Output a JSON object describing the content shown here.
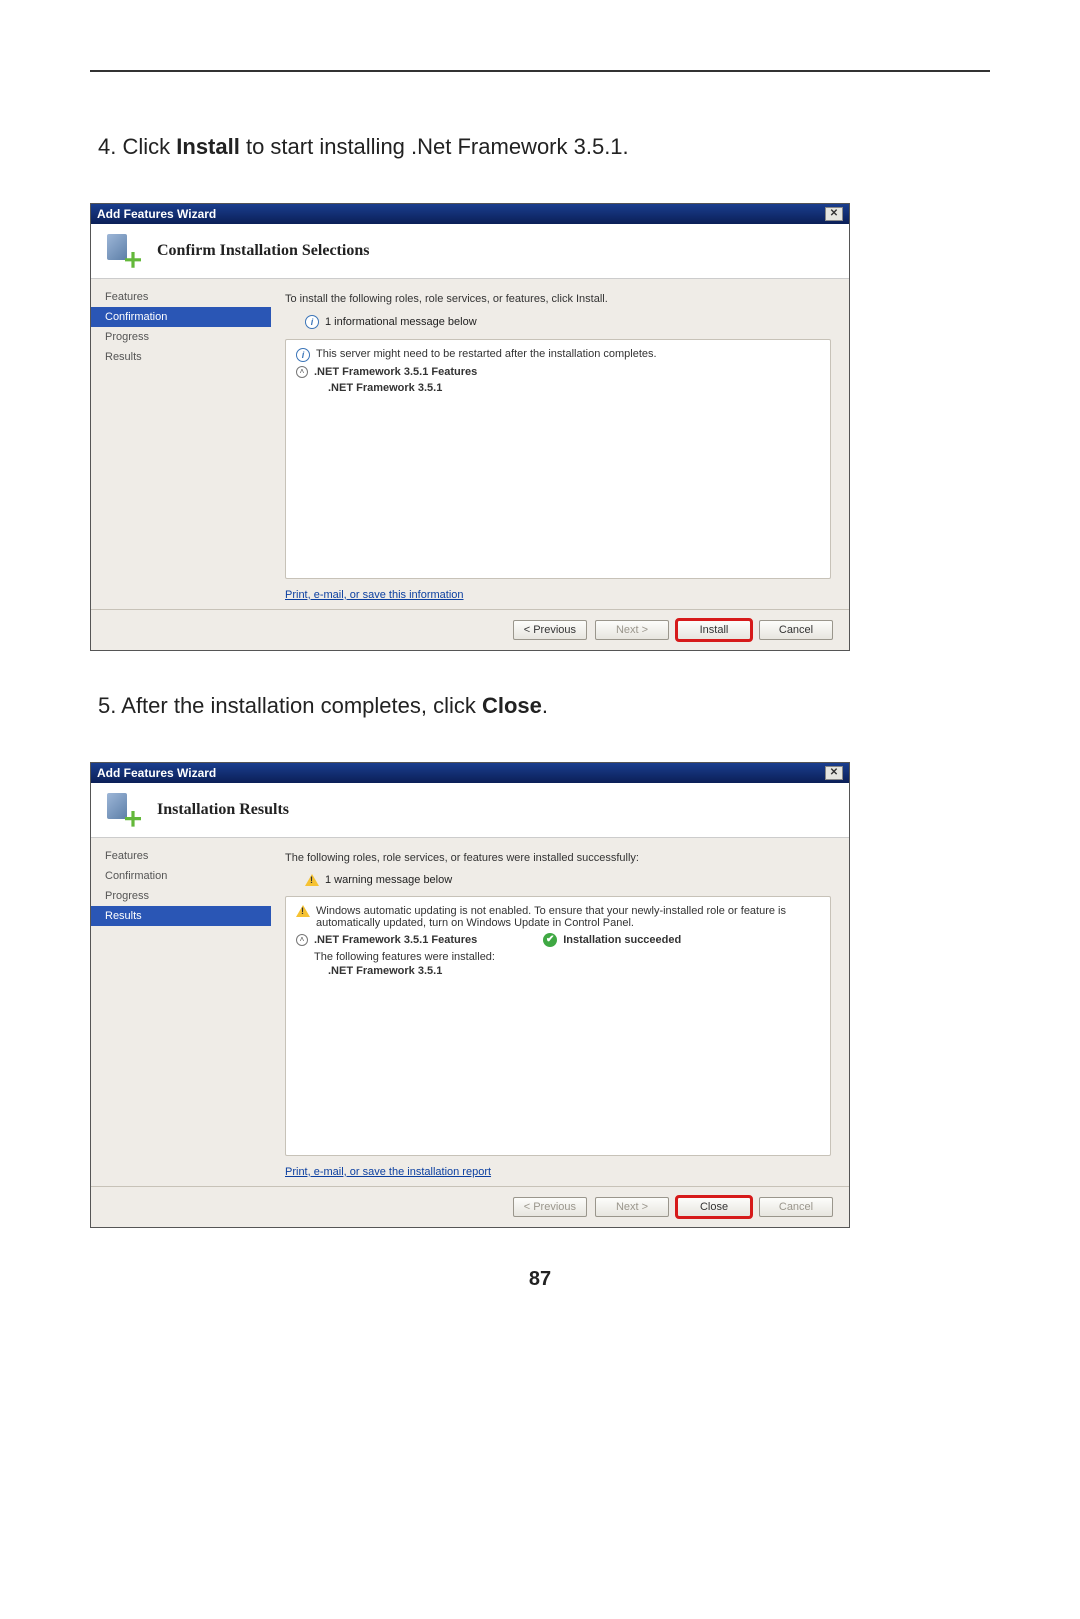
{
  "step4": {
    "num": "4.",
    "pre": "Click ",
    "bold": "Install",
    "post": " to start installing .Net Framework 3.5.1."
  },
  "step5": {
    "num": "5.",
    "pre": "After the installation completes, click ",
    "bold": "Close",
    "post": "."
  },
  "wizard1": {
    "title": "Add Features Wizard",
    "headerTitle": "Confirm Installation Selections",
    "nav": {
      "features": "Features",
      "confirmation": "Confirmation",
      "progress": "Progress",
      "results": "Results"
    },
    "intro": "To install the following roles, role services, or features, click Install.",
    "msgCount": "1 informational message below",
    "warnMsg": "This server might need to be restarted after the installation completes.",
    "featureHeading": ".NET Framework 3.5.1 Features",
    "featureSub": ".NET Framework 3.5.1",
    "link": "Print, e-mail, or save this information",
    "buttons": {
      "prev": "< Previous",
      "next": "Next >",
      "install": "Install",
      "cancel": "Cancel"
    }
  },
  "wizard2": {
    "title": "Add Features Wizard",
    "headerTitle": "Installation Results",
    "nav": {
      "features": "Features",
      "confirmation": "Confirmation",
      "progress": "Progress",
      "results": "Results"
    },
    "intro": "The following roles, role services, or features were installed successfully:",
    "msgCount": "1 warning message below",
    "warnMsg": "Windows automatic updating is not enabled. To ensure that your newly-installed role or feature is automatically updated, turn on Windows Update in Control Panel.",
    "featureHeading": ".NET Framework 3.5.1 Features",
    "successLabel": "Installation succeeded",
    "subIntro": "The following features were installed:",
    "featureSub": ".NET Framework 3.5.1",
    "link": "Print, e-mail, or save the installation report",
    "buttons": {
      "prev": "< Previous",
      "next": "Next >",
      "close": "Close",
      "cancel": "Cancel"
    }
  },
  "pageNumber": "87"
}
